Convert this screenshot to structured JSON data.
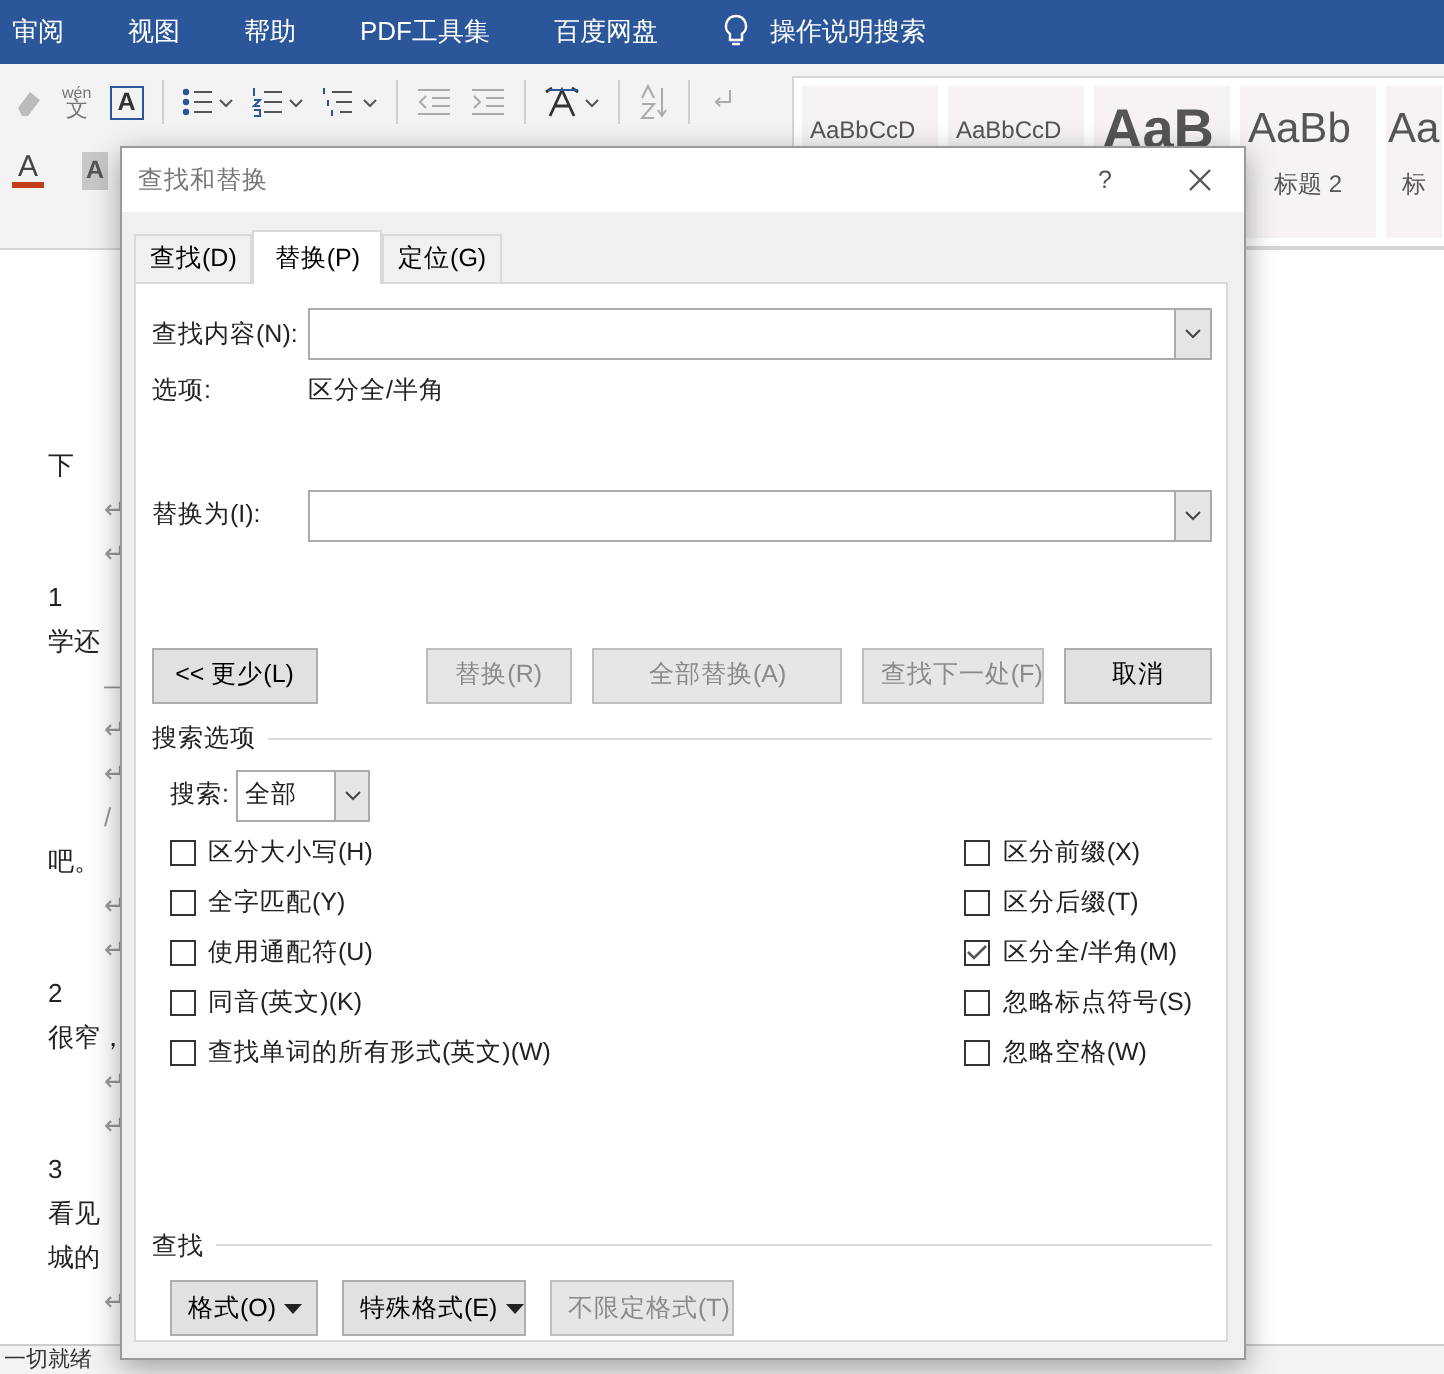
{
  "menu_tabs": [
    {
      "label": "审阅"
    },
    {
      "label": "视图"
    },
    {
      "label": "帮助"
    },
    {
      "label": "PDF工具集"
    },
    {
      "label": "百度网盘"
    }
  ],
  "tell_me": {
    "label": "操作说明搜索"
  },
  "toolbar": {
    "row1": [
      {
        "kind": "eraser"
      },
      {
        "kind": "phonetic",
        "ruby": "wén",
        "glyph": "文"
      },
      {
        "kind": "boxed",
        "glyph": "A"
      },
      {
        "kind": "sep"
      },
      {
        "kind": "bullets"
      },
      {
        "kind": "numbering"
      },
      {
        "kind": "multilevel"
      },
      {
        "kind": "sep"
      },
      {
        "kind": "outdent"
      },
      {
        "kind": "indent"
      },
      {
        "kind": "sep"
      },
      {
        "kind": "asian"
      },
      {
        "kind": "sep"
      },
      {
        "kind": "sort"
      },
      {
        "kind": "sep"
      },
      {
        "kind": "marks"
      }
    ],
    "row2": [
      {
        "kind": "fontcolor",
        "glyph": "A",
        "color": "#c43e1c"
      },
      {
        "kind": "shade",
        "glyph": "A"
      }
    ]
  },
  "styles": [
    {
      "sample": "AaBbCcD",
      "kind": "body"
    },
    {
      "sample": "AaBbCcD",
      "kind": "body"
    },
    {
      "sample": "AaB",
      "kind": "title"
    },
    {
      "sample": "AaBb",
      "kind": "heading",
      "label": "标题 2"
    },
    {
      "sample": "Aa",
      "kind": "heading",
      "label": "标"
    }
  ],
  "document": {
    "lines": [
      {
        "text": "下"
      },
      {
        "text": "↵",
        "kind": "mark"
      },
      {
        "text": "↵",
        "kind": "mark"
      },
      {
        "text": "1"
      },
      {
        "text": "学还"
      },
      {
        "text": "—",
        "kind": "mark"
      },
      {
        "text": "↵",
        "kind": "mark"
      },
      {
        "text": "↵",
        "kind": "mark"
      },
      {
        "text": "/",
        "kind": "mark"
      },
      {
        "text": "吧。"
      },
      {
        "text": "↵",
        "kind": "mark"
      },
      {
        "text": "↵",
        "kind": "mark"
      },
      {
        "text": "2"
      },
      {
        "text": "很窄，"
      },
      {
        "text": "↵",
        "kind": "mark"
      },
      {
        "text": "↵",
        "kind": "mark"
      },
      {
        "text": "3"
      },
      {
        "text": "看见"
      },
      {
        "text": "城的"
      },
      {
        "text": "↵",
        "kind": "mark"
      }
    ]
  },
  "status_bar": {
    "text": "一切就绪"
  },
  "dialog": {
    "title": "查找和替换",
    "help": "?",
    "tabs": [
      {
        "label": "查找(D)",
        "selected": false
      },
      {
        "label": "替换(P)",
        "selected": true
      },
      {
        "label": "定位(G)",
        "selected": false
      }
    ],
    "find": {
      "label": "查找内容(N):"
    },
    "options": {
      "label": "选项:",
      "value": "区分全/半角"
    },
    "replace": {
      "label": "替换为(I):"
    },
    "buttons": [
      {
        "label": "<< 更少(L)",
        "disabled": false
      },
      {
        "label": "替换(R)",
        "disabled": true
      },
      {
        "label": "全部替换(A)",
        "disabled": true
      },
      {
        "label": "查找下一处(F)",
        "disabled": true
      },
      {
        "label": "取消",
        "disabled": false
      }
    ],
    "search_options": {
      "title": "搜索选项",
      "direction_label": "搜索:",
      "direction": "全部",
      "left_checks": [
        {
          "label": "区分大小写(H)",
          "checked": false
        },
        {
          "label": "全字匹配(Y)",
          "checked": false
        },
        {
          "label": "使用通配符(U)",
          "checked": false
        },
        {
          "label": "同音(英文)(K)",
          "checked": false
        },
        {
          "label": "查找单词的所有形式(英文)(W)",
          "checked": false
        }
      ],
      "right_checks": [
        {
          "label": "区分前缀(X)",
          "checked": false
        },
        {
          "label": "区分后缀(T)",
          "checked": false
        },
        {
          "label": "区分全/半角(M)",
          "checked": true
        },
        {
          "label": "忽略标点符号(S)",
          "checked": false
        },
        {
          "label": "忽略空格(W)",
          "checked": false
        }
      ]
    },
    "format": {
      "title": "查找",
      "buttons": [
        {
          "label": "格式(O)",
          "dropdown": true,
          "disabled": false
        },
        {
          "label": "特殊格式(E)",
          "dropdown": true,
          "disabled": false
        },
        {
          "label": "不限定格式(T)",
          "dropdown": false,
          "disabled": true
        }
      ]
    }
  }
}
